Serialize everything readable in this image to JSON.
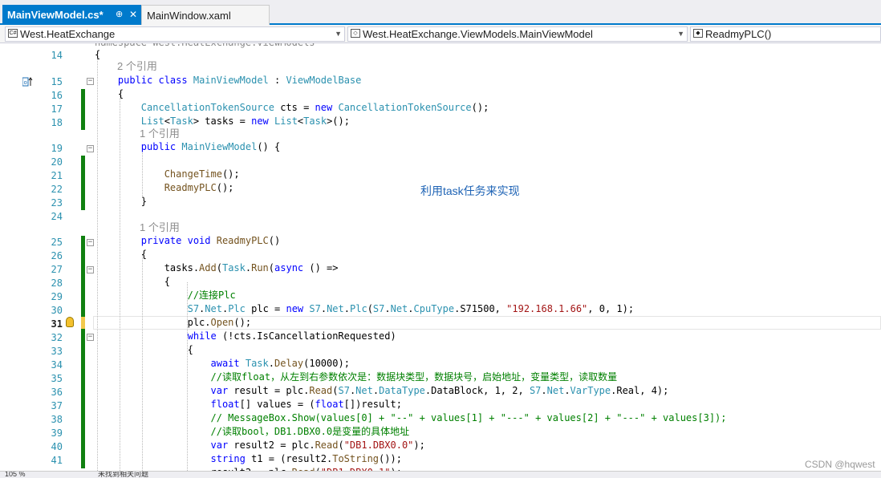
{
  "tabs": [
    {
      "label": "MainViewModel.cs*",
      "pin": "⊕",
      "close": "✕"
    },
    {
      "label": "MainWindow.xaml"
    }
  ],
  "navbar": {
    "project": "West.HeatExchange",
    "class": "West.HeatExchange.ViewModels.MainViewModel",
    "member": "ReadmyPLC()"
  },
  "editor": {
    "truncated_top": "namespace West.HeatExchange.ViewModels",
    "refs_2": "2 个引用",
    "refs_1": "1 个引用",
    "line_numbers": [
      "14",
      "15",
      "16",
      "17",
      "18",
      "19",
      "20",
      "21",
      "22",
      "23",
      "24",
      "25",
      "26",
      "27",
      "28",
      "29",
      "30",
      "31",
      "32",
      "33",
      "34",
      "35",
      "36",
      "37",
      "38",
      "39",
      "40",
      "41"
    ],
    "current_line": "31"
  },
  "annotation": "利用task任务来实现",
  "status": {
    "zoom": "105 %",
    "issues": "未找到相关问题"
  },
  "watermark": "CSDN @hqwest",
  "colors": {
    "accent": "#007acc",
    "keyword": "#0000ff",
    "type": "#2b91af",
    "comment": "#008000",
    "string": "#a31515",
    "changed": "#108010"
  }
}
